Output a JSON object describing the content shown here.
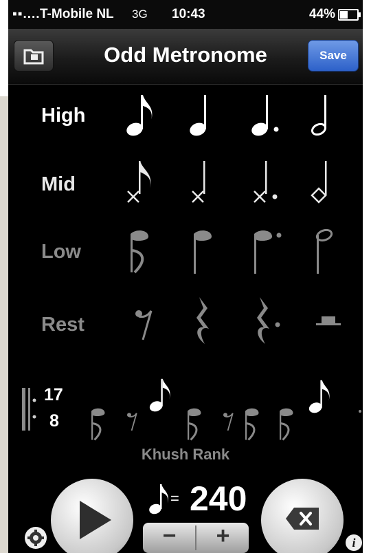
{
  "status": {
    "signal": "▪▪....",
    "carrier": "T-Mobile NL",
    "network": "3G",
    "time": "10:43",
    "battery": "44%"
  },
  "nav": {
    "title": "Odd Metronome",
    "save_label": "Save",
    "left_icon": "folder-icon"
  },
  "rows": {
    "high": "High",
    "mid": "Mid",
    "low": "Low",
    "rest": "Rest"
  },
  "colors": {
    "high": "#ffffff",
    "mid": "#e8e8e8",
    "low": "#8a8a8a",
    "rest": "#8a8a8a",
    "save": "#3a6fd6"
  },
  "time_signature": {
    "top": "17",
    "bottom": "8"
  },
  "pattern_name": "Khush Rank",
  "tempo": {
    "equals": "=",
    "value": "240",
    "minus": "−",
    "plus": "+"
  }
}
